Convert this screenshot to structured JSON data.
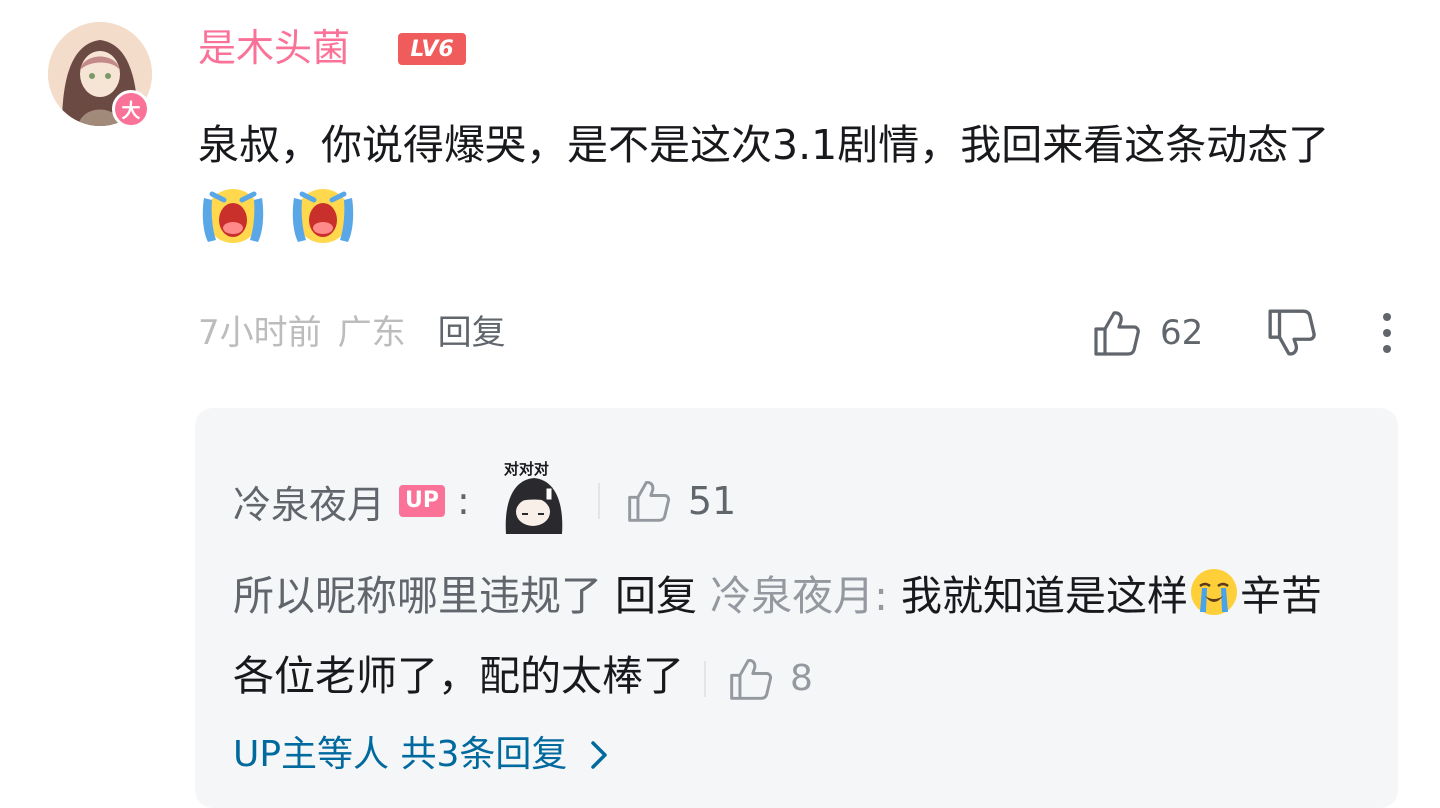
{
  "comment": {
    "username": "是木头菌",
    "level": "LV6",
    "vip_badge": "大",
    "text_part1": "泉叔，你说得爆哭，是不是这次3.1剧情，我回来看这条动态了",
    "time": "7小时前",
    "location": "广东",
    "reply_label": "回复",
    "likes": "62"
  },
  "replies": {
    "first": {
      "user": "冷泉夜月",
      "tag": "UP",
      "colon": ":",
      "sticker_text": "对对对",
      "likes": "51"
    },
    "second": {
      "user_text": "所以昵称哪里违规了",
      "reply_word": "回复",
      "target": "冷泉夜月:",
      "text_a": "我就知道是这样",
      "text_b": "辛苦各位老师了，配的太棒了",
      "likes": "8"
    },
    "more_link": "UP主等人 共3条回复"
  },
  "colors": {
    "pink": "#fb7299",
    "level_red": "#f05b5b",
    "link_blue": "#00699d",
    "reply_bg": "#f5f6f8"
  },
  "icons": [
    "avatar",
    "vip-badge",
    "crying-emoji",
    "thumbs-up-icon",
    "thumbs-down-icon",
    "more-icon",
    "sticker",
    "sob-emoji",
    "chevron-right-icon"
  ]
}
